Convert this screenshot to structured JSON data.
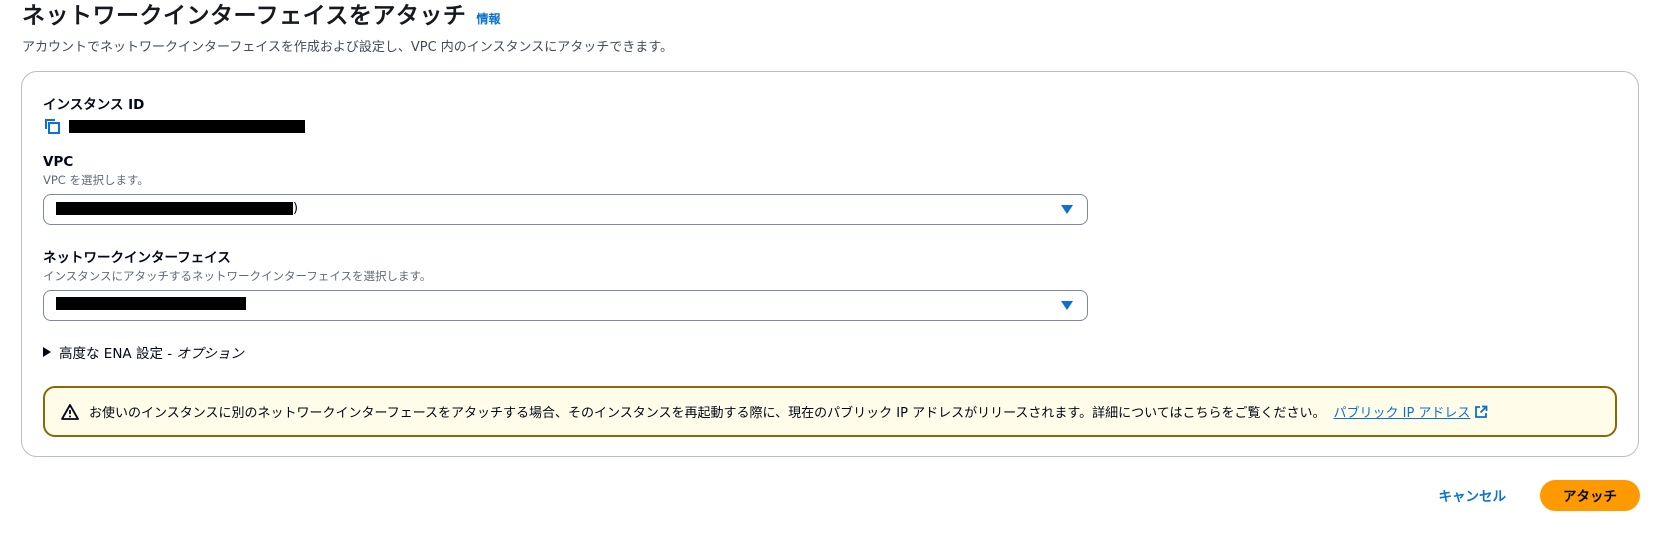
{
  "header": {
    "title": "ネットワークインターフェイスをアタッチ",
    "info_link": "情報",
    "description": "アカウントでネットワークインターフェイスを作成および設定し、VPC 内のインスタンスにアタッチできます。"
  },
  "instance": {
    "label": "インスタンス ID",
    "copy_icon": "copy-icon",
    "value_redacted": true
  },
  "vpc": {
    "label": "VPC",
    "description": "VPC を選択します。",
    "selected_suffix": ")",
    "value_redacted": true
  },
  "network_interface": {
    "label": "ネットワークインターフェイス",
    "description": "インスタンスにアタッチするネットワークインターフェイスを選択します。",
    "value_redacted": true
  },
  "advanced": {
    "label_main": "高度な ENA 設定 - ",
    "label_optional": "オプション",
    "expanded": false
  },
  "alert": {
    "icon": "warning-icon",
    "text": "お使いのインスタンスに別のネットワークインターフェースをアタッチする場合、そのインスタンスを再起動する際に、現在のパブリック IP アドレスがリリースされます。詳細についてはこちらをご覧ください。",
    "link_text": "パブリック IP アドレス",
    "link_icon": "external-link-icon"
  },
  "footer": {
    "cancel_label": "キャンセル",
    "attach_label": "アタッチ"
  },
  "colors": {
    "accent": "#0972d3",
    "primary_button": "#ff9900",
    "warning_border": "#8d6605",
    "warning_background": "#fffce9"
  }
}
